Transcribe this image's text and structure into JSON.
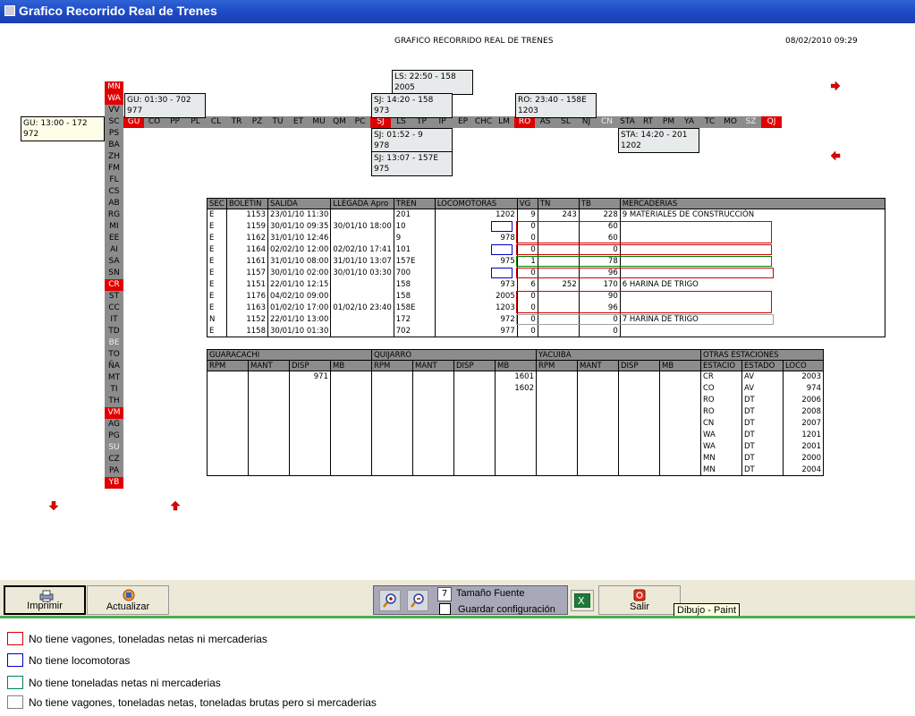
{
  "window": {
    "title": "Grafico Recorrido Real de Trenes"
  },
  "report": {
    "title": "GRAFICO RECORRIDO REAL DE TRENES",
    "datetime": "08/02/2010 09:29"
  },
  "vstations": [
    {
      "label": "MN",
      "style": "red"
    },
    {
      "label": "WA",
      "style": "red"
    },
    {
      "label": "VV",
      "style": ""
    },
    {
      "label": "SC",
      "style": ""
    },
    {
      "label": "PS",
      "style": ""
    },
    {
      "label": "BA",
      "style": ""
    },
    {
      "label": "ZH",
      "style": ""
    },
    {
      "label": "FM",
      "style": ""
    },
    {
      "label": "FL",
      "style": ""
    },
    {
      "label": "CS",
      "style": ""
    },
    {
      "label": "AB",
      "style": ""
    },
    {
      "label": "RG",
      "style": ""
    },
    {
      "label": "MI",
      "style": ""
    },
    {
      "label": "EE",
      "style": ""
    },
    {
      "label": "AI",
      "style": ""
    },
    {
      "label": "SA",
      "style": ""
    },
    {
      "label": "SN",
      "style": ""
    },
    {
      "label": "CR",
      "style": "red"
    },
    {
      "label": "ST",
      "style": ""
    },
    {
      "label": "CC",
      "style": ""
    },
    {
      "label": "IT",
      "style": ""
    },
    {
      "label": "TD",
      "style": ""
    },
    {
      "label": "BE",
      "style": "white"
    },
    {
      "label": "TO",
      "style": ""
    },
    {
      "label": "ÑA",
      "style": ""
    },
    {
      "label": "MT",
      "style": ""
    },
    {
      "label": "TI",
      "style": ""
    },
    {
      "label": "TH",
      "style": ""
    },
    {
      "label": "VM",
      "style": "red"
    },
    {
      "label": "AG",
      "style": ""
    },
    {
      "label": "PG",
      "style": ""
    },
    {
      "label": "SU",
      "style": "white"
    },
    {
      "label": "CZ",
      "style": ""
    },
    {
      "label": "PA",
      "style": ""
    },
    {
      "label": "YB",
      "style": "red"
    }
  ],
  "hstations": [
    {
      "label": "GU",
      "style": "red"
    },
    {
      "label": "CO",
      "style": ""
    },
    {
      "label": "PP",
      "style": ""
    },
    {
      "label": "PL",
      "style": ""
    },
    {
      "label": "CL",
      "style": ""
    },
    {
      "label": "TR",
      "style": ""
    },
    {
      "label": "PZ",
      "style": ""
    },
    {
      "label": "TU",
      "style": ""
    },
    {
      "label": "ET",
      "style": ""
    },
    {
      "label": "MU",
      "style": ""
    },
    {
      "label": "QM",
      "style": ""
    },
    {
      "label": "PC",
      "style": ""
    },
    {
      "label": "SJ",
      "style": "red"
    },
    {
      "label": "LS",
      "style": ""
    },
    {
      "label": "TP",
      "style": ""
    },
    {
      "label": "IP",
      "style": ""
    },
    {
      "label": "EP",
      "style": ""
    },
    {
      "label": "CHC",
      "style": ""
    },
    {
      "label": "LM",
      "style": ""
    },
    {
      "label": "RO",
      "style": "red"
    },
    {
      "label": "AS",
      "style": ""
    },
    {
      "label": "SL",
      "style": ""
    },
    {
      "label": "NJ",
      "style": ""
    },
    {
      "label": "CN",
      "style": "white"
    },
    {
      "label": "STA",
      "style": ""
    },
    {
      "label": "RT",
      "style": ""
    },
    {
      "label": "PM",
      "style": ""
    },
    {
      "label": "YA",
      "style": ""
    },
    {
      "label": "TC",
      "style": ""
    },
    {
      "label": "MO",
      "style": ""
    },
    {
      "label": "SZ",
      "style": "white"
    },
    {
      "label": "QJ",
      "style": "red"
    }
  ],
  "train_boxes": [
    {
      "line1": "LS: 22:50 - 158",
      "line2": "2005"
    },
    {
      "line1": "GU: 01:30 - 702",
      "line2": "977"
    },
    {
      "line1": "SJ: 14:20 - 158",
      "line2": "973"
    },
    {
      "line1": "RO: 23:40 - 158E",
      "line2": "1203"
    },
    {
      "line1": "GU: 13:00 - 172",
      "line2": "972"
    },
    {
      "line1": "SJ: 01:52 - 9",
      "line2": "978"
    },
    {
      "line1": "STA: 14:20 - 201",
      "line2": "1202"
    },
    {
      "line1": "SJ: 13:07 - 157E",
      "line2": "975"
    }
  ],
  "trains_table": {
    "headers": [
      "SEC",
      "BOLETIN",
      "SALIDA",
      "LLEGADA Apro",
      "TREN",
      "LOCOMOTORAS",
      "VG",
      "TN",
      "TB",
      "MERCADERIAS"
    ],
    "rows": [
      [
        "E",
        "1153",
        "23/01/10 11:30",
        "",
        "201",
        "1202",
        "9",
        "243",
        "228",
        "9 MATERIALES DE CONSTRUCCIÓN"
      ],
      [
        "E",
        "1159",
        "30/01/10 09:35",
        "30/01/10 18:00",
        "10",
        "",
        "0",
        "",
        "60",
        ""
      ],
      [
        "E",
        "1162",
        "31/01/10 12:46",
        "",
        "9",
        "978",
        "0",
        "",
        "60",
        ""
      ],
      [
        "E",
        "1164",
        "02/02/10 12:00",
        "02/02/10 17:41",
        "101",
        "",
        "0",
        "",
        "0",
        ""
      ],
      [
        "E",
        "1161",
        "31/01/10 08:00",
        "31/01/10 13:07",
        "157E",
        "975",
        "1",
        "",
        "78",
        ""
      ],
      [
        "E",
        "1157",
        "30/01/10 02:00",
        "30/01/10 03:30",
        "700",
        "",
        "0",
        "",
        "96",
        ""
      ],
      [
        "E",
        "1151",
        "22/01/10 12:15",
        "",
        "158",
        "973",
        "6",
        "252",
        "170",
        "6 HARINA DE TRIGO"
      ],
      [
        "E",
        "1176",
        "04/02/10 09:00",
        "",
        "158",
        "2005",
        "0",
        "",
        "90",
        ""
      ],
      [
        "E",
        "1163",
        "01/02/10 17:00",
        "01/02/10 23:40",
        "158E",
        "1203",
        "0",
        "",
        "96",
        ""
      ],
      [
        "N",
        "1152",
        "22/01/10 13:00",
        "",
        "172",
        "972",
        "0",
        "",
        "0",
        "7 HARINA DE TRIGO"
      ],
      [
        "E",
        "1158",
        "30/01/10 01:30",
        "",
        "702",
        "977",
        "0",
        "",
        "0",
        ""
      ]
    ]
  },
  "stations_table": {
    "groups": [
      "GUARACACHI",
      "QUIJARRO",
      "YACUIBA",
      "OTRAS ESTACIONES"
    ],
    "sub": [
      "RPM",
      "MANT",
      "DISP",
      "MB",
      "RPM",
      "MANT",
      "DISP",
      "MB",
      "RPM",
      "MANT",
      "DISP",
      "MB",
      "ESTACIO",
      "ESTADO",
      "LOCO"
    ],
    "values": {
      "gu_disp": "971",
      "qu_mb": [
        "1601",
        "1602"
      ]
    },
    "otras": [
      [
        "CR",
        "AV",
        "2003"
      ],
      [
        "CO",
        "AV",
        "974"
      ],
      [
        "RO",
        "DT",
        "2006"
      ],
      [
        "RO",
        "DT",
        "2008"
      ],
      [
        "CN",
        "DT",
        "2007"
      ],
      [
        "WA",
        "DT",
        "1201"
      ],
      [
        "WA",
        "DT",
        "2001"
      ],
      [
        "MN",
        "DT",
        "2000"
      ],
      [
        "MN",
        "DT",
        "2004"
      ]
    ]
  },
  "toolbar": {
    "print": "Imprimir",
    "refresh": "Actualizar",
    "font_size_value": "7",
    "font_size_label": "Tamaño Fuente",
    "save_config": "Guardar configuración",
    "exit": "Salir",
    "tooltip": "Dibujo - Paint"
  },
  "legend": [
    {
      "text": "No tiene vagones, toneladas netas ni mercaderias",
      "color": "#d00000"
    },
    {
      "text": "No tiene locomotoras",
      "color": "#0000c0"
    },
    {
      "text": "No tiene toneladas netas ni mercaderias",
      "color": "#008060"
    },
    {
      "text": "No tiene vagones, toneladas netas, toneladas brutas pero si mercaderias",
      "color": "#808080"
    }
  ]
}
